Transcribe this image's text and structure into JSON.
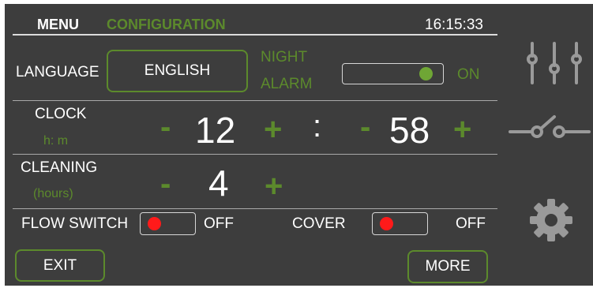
{
  "header": {
    "menu_label": "MENU",
    "section_label": "CONFIGURATION",
    "time": "16:15:33"
  },
  "language": {
    "label": "LANGUAGE",
    "button_label": "ENGLISH"
  },
  "night_alarm": {
    "label_line1": "NIGHT",
    "label_line2": "ALARM",
    "state": "ON",
    "knob_color": "#6fa635"
  },
  "clock": {
    "label": "CLOCK",
    "sublabel": "h: m",
    "hours": "12",
    "minutes": "58",
    "separator": ":",
    "minus": "-",
    "plus": "+"
  },
  "cleaning": {
    "label": "CLEANING",
    "sublabel": "(hours)",
    "value": "4",
    "minus": "-",
    "plus": "+"
  },
  "flow_switch": {
    "label": "FLOW SWITCH",
    "state": "OFF",
    "knob_color": "#ff1a1a"
  },
  "cover": {
    "label": "COVER",
    "state": "OFF",
    "knob_color": "#ff1a1a"
  },
  "footer": {
    "exit_label": "EXIT",
    "more_label": "MORE"
  },
  "sidebar": {
    "icons": [
      "sliders-icon",
      "switch-icon",
      "gear-icon"
    ]
  },
  "colors": {
    "background": "#3d3d3d",
    "accent_green": "#5c8a2c",
    "icon_gray": "#9a9a9a"
  }
}
